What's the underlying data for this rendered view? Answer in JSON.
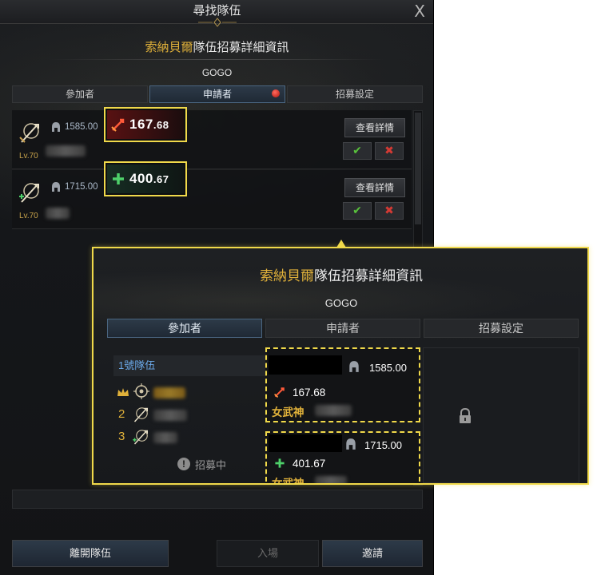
{
  "window": {
    "title": "尋找隊伍",
    "close_label": "X"
  },
  "recruit": {
    "title_highlight": "索納貝爾",
    "title_rest": "隊伍招募詳細資訊",
    "party_name": "GOGO"
  },
  "tabs": [
    {
      "label": "參加者"
    },
    {
      "label": "申請者",
      "has_notification": true
    },
    {
      "label": "招募設定"
    }
  ],
  "applicants": [
    {
      "level": "Lv.70",
      "gear_score": "1585.00",
      "stat_icon": "sword-icon",
      "stat_value_main": "167",
      "stat_value_dec": ".68",
      "detail_label": "查看詳情",
      "accept_label": "✔",
      "reject_label": "✖"
    },
    {
      "level": "Lv.70",
      "gear_score": "1715.00",
      "stat_icon": "plus-icon",
      "stat_value_main": "400",
      "stat_value_dec": ".67",
      "detail_label": "查看詳情",
      "accept_label": "✔",
      "reject_label": "✖"
    }
  ],
  "bottom_buttons": {
    "leave": "離開隊伍",
    "enter": "入場",
    "invite": "邀請"
  },
  "overlay": {
    "title_highlight": "索納貝爾",
    "title_rest": "隊伍招募詳細資訊",
    "party_name": "GOGO",
    "tabs": [
      "參加者",
      "申請者",
      "招募設定"
    ],
    "party_label": "1號隊伍",
    "members": [
      {
        "number": "",
        "leader": true
      },
      {
        "number": "2",
        "leader": false
      },
      {
        "number": "3",
        "leader": false
      }
    ],
    "recruiting_label": "招募中",
    "slots": [
      {
        "gear_score": "1585.00",
        "stat_icon": "sword-icon",
        "stat_value": "167.68",
        "class_name": "女武神"
      },
      {
        "gear_score": "1715.00",
        "stat_icon": "plus-icon",
        "stat_value": "401.67",
        "class_name": "女武神"
      }
    ]
  },
  "colors": {
    "highlight_border": "#f0d94a",
    "gold_text": "#e0b13a",
    "party_blue": "#6aa8e8",
    "accept_green": "#59c23c",
    "reject_red": "#d43a34"
  }
}
